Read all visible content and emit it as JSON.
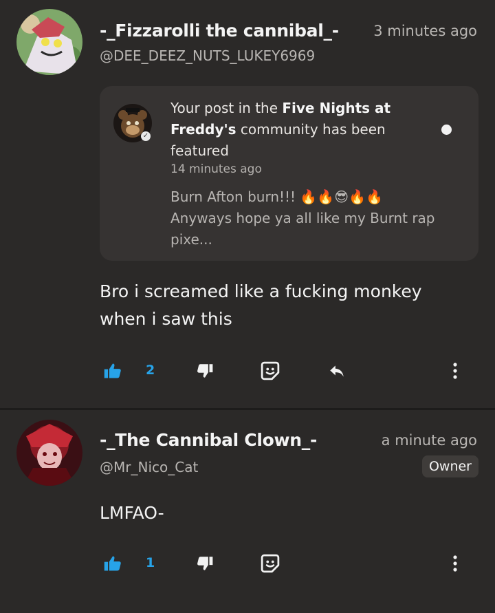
{
  "comments": [
    {
      "username": "-_Fizzarolli the cannibal_-",
      "handle": "@DEE_DEEZ_NUTS_LUKEY6969",
      "time": "3 minutes ago",
      "shared_post": {
        "title_prefix": "Your post in the ",
        "community_name": "Five Nights at Freddy's",
        "title_suffix": " community has been featured",
        "time": "14 minutes ago",
        "excerpt_line1": "Burn Afton burn!!! 🔥🔥😎🔥🔥",
        "excerpt_line2": "Anyways hope ya all like my Burnt rap pixe..."
      },
      "text": "Bro i screamed like a fucking monkey when i saw this",
      "likes": "2"
    },
    {
      "username": "-_The Cannibal Clown_-",
      "handle": "@Mr_Nico_Cat",
      "time": "a minute ago",
      "badge": "Owner",
      "text": "LMFAO-",
      "likes": "1"
    }
  ],
  "icons": {
    "like": "thumbs-up-icon",
    "dislike": "thumbs-down-icon",
    "sticker": "sticker-icon",
    "reply": "reply-icon",
    "more": "more-vertical-icon",
    "verified": "verified-check-icon"
  },
  "colors": {
    "background": "#2b2928",
    "card": "#363332",
    "accent": "#27a3e8"
  }
}
